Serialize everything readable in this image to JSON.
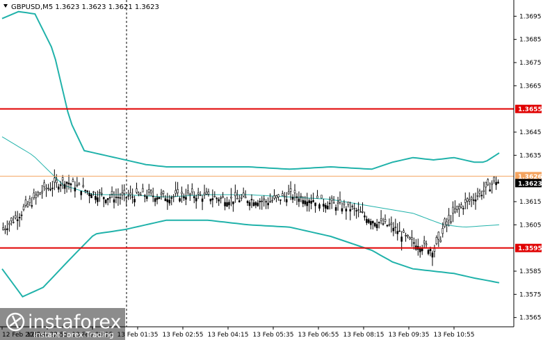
{
  "header": {
    "symbol_line": "GBPUSD,M5  1.3623 1.3623 1.3621 1.3623"
  },
  "logo": {
    "brand": "instaforex",
    "tagline": "Instant Forex Trading"
  },
  "colors": {
    "level_line": "#e00000",
    "bollinger": "#20b2aa",
    "candle": "#000000",
    "bid_line": "#f4a460",
    "price_badge": "#000000",
    "level_badge": "#e00000"
  },
  "chart_data": {
    "type": "candlestick",
    "symbol": "GBPUSD",
    "timeframe": "M5",
    "ohlc_last": {
      "open": 1.3623,
      "high": 1.3623,
      "low": 1.3621,
      "close": 1.3623
    },
    "ylim": [
      1.3561,
      1.3702
    ],
    "yticks": [
      "1.3695",
      "1.3685",
      "1.3675",
      "1.3665",
      "1.3645",
      "1.3635",
      "1.3615",
      "1.3605",
      "1.3585",
      "1.3575",
      "1.3565"
    ],
    "xticks": [
      "12 Feb 2021",
      "12 Feb 22:55",
      "13 Feb 00:15",
      "13 Feb 01:35",
      "13 Feb 02:55",
      "13 Feb 04:15",
      "13 Feb 05:35",
      "13 Feb 06:55",
      "13 Feb 08:15",
      "13 Feb 09:35",
      "13 Feb 10:55"
    ],
    "levels": [
      {
        "label": "1.3655",
        "value": 1.3655
      },
      {
        "label": "1.3595",
        "value": 1.3595
      }
    ],
    "bid_line": {
      "label": "1.3626",
      "value": 1.3626
    },
    "current_price": {
      "label": "1.3623",
      "value": 1.3623
    },
    "close_path": [
      [
        0,
        1.3603
      ],
      [
        10,
        1.3611
      ],
      [
        20,
        1.362
      ],
      [
        30,
        1.3624
      ],
      [
        40,
        1.362
      ],
      [
        50,
        1.3617
      ],
      [
        60,
        1.3617
      ],
      [
        70,
        1.3618
      ],
      [
        80,
        1.3617
      ],
      [
        90,
        1.3618
      ],
      [
        100,
        1.3617
      ],
      [
        110,
        1.3616
      ],
      [
        120,
        1.3616
      ],
      [
        130,
        1.3615
      ],
      [
        140,
        1.3618
      ],
      [
        150,
        1.3616
      ],
      [
        160,
        1.3614
      ],
      [
        170,
        1.3612
      ],
      [
        180,
        1.3607
      ],
      [
        190,
        1.3604
      ],
      [
        198,
        1.3598
      ],
      [
        205,
        1.3596
      ],
      [
        210,
        1.3594
      ],
      [
        213,
        1.3599
      ],
      [
        216,
        1.3605
      ],
      [
        220,
        1.361
      ],
      [
        225,
        1.3614
      ],
      [
        230,
        1.3617
      ],
      [
        235,
        1.362
      ],
      [
        240,
        1.3624
      ],
      [
        242,
        1.3623
      ]
    ],
    "bollinger_upper": [
      [
        0,
        1.3694
      ],
      [
        8,
        1.3697
      ],
      [
        16,
        1.3696
      ],
      [
        25,
        1.368
      ],
      [
        33,
        1.365
      ],
      [
        40,
        1.3637
      ],
      [
        50,
        1.3635
      ],
      [
        60,
        1.3633
      ],
      [
        70,
        1.3631
      ],
      [
        80,
        1.363
      ],
      [
        100,
        1.363
      ],
      [
        120,
        1.363
      ],
      [
        140,
        1.3629
      ],
      [
        160,
        1.363
      ],
      [
        180,
        1.3629
      ],
      [
        190,
        1.3632
      ],
      [
        200,
        1.3634
      ],
      [
        210,
        1.3633
      ],
      [
        220,
        1.3634
      ],
      [
        230,
        1.3632
      ],
      [
        235,
        1.3632
      ],
      [
        242,
        1.3636
      ]
    ],
    "bollinger_middle": [
      [
        0,
        1.3643
      ],
      [
        15,
        1.3635
      ],
      [
        30,
        1.3622
      ],
      [
        45,
        1.3618
      ],
      [
        60,
        1.3618
      ],
      [
        80,
        1.3617
      ],
      [
        100,
        1.3618
      ],
      [
        120,
        1.3618
      ],
      [
        140,
        1.3617
      ],
      [
        160,
        1.3616
      ],
      [
        180,
        1.3613
      ],
      [
        200,
        1.361
      ],
      [
        215,
        1.3605
      ],
      [
        225,
        1.3604
      ],
      [
        242,
        1.3605
      ]
    ],
    "bollinger_lower": [
      [
        0,
        1.3586
      ],
      [
        10,
        1.3574
      ],
      [
        20,
        1.3578
      ],
      [
        35,
        1.3592
      ],
      [
        45,
        1.3601
      ],
      [
        60,
        1.3603
      ],
      [
        80,
        1.3607
      ],
      [
        100,
        1.3607
      ],
      [
        120,
        1.3605
      ],
      [
        140,
        1.3604
      ],
      [
        160,
        1.36
      ],
      [
        180,
        1.3594
      ],
      [
        190,
        1.3589
      ],
      [
        200,
        1.3586
      ],
      [
        210,
        1.3585
      ],
      [
        220,
        1.3584
      ],
      [
        230,
        1.3582
      ],
      [
        242,
        1.358
      ]
    ]
  }
}
